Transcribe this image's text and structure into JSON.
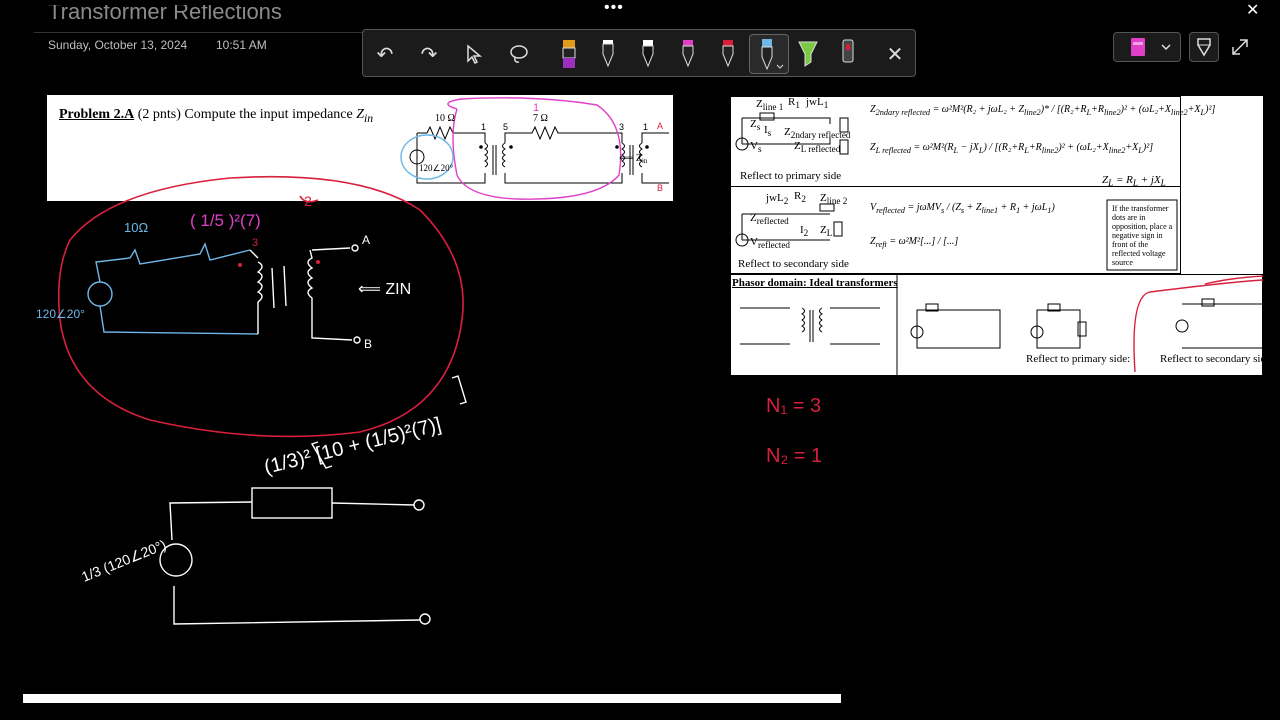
{
  "window": {
    "menu_dots": "•••",
    "close_glyph": "✕"
  },
  "page": {
    "title": "Transformer Reflections",
    "date": "Sunday, October 13, 2024",
    "time": "10:51 AM"
  },
  "toolbar": {
    "undo": "↶",
    "redo": "↷",
    "close": "✕"
  },
  "problem": {
    "heading": "Problem 2.A",
    "points": "(2 pnts)",
    "prompt": "Compute the input impedance",
    "symbol": "Z",
    "subscript": "in",
    "circuit": {
      "r1": "10 Ω",
      "r2": "7 Ω",
      "n1": "1",
      "n2": "5",
      "n3": "3",
      "n4": "1",
      "source": "120∠20°",
      "zin": "⟸ Z",
      "zin_sub": "in",
      "term_a": "A",
      "term_b": "B",
      "mark": "1"
    }
  },
  "reference": {
    "zline1": "Z",
    "zline1_sub": "line 1",
    "r1": "R",
    "r1_sub": "1",
    "jwl1": "jwL",
    "jwl1_sub": "1",
    "zs": "Z",
    "zs_sub": "s",
    "is": "I",
    "is_sub": "s",
    "z2ref": "Z",
    "z2ref_sub": "2ndary reflected",
    "zlref": "Z",
    "zlref_sub": "L reflected",
    "vs": "V",
    "vs_sub": "s",
    "reflect_primary": "Reflect to primary side",
    "zl_eq": "Z",
    "zl_eq_sub": "L",
    "zl_eq_rest": " = R",
    "zl_eq_r_sub": "L",
    "zl_eq_tail": " + jX",
    "zl_eq_x_sub": "L",
    "jwl2": "jwL",
    "jwl2_sub": "2",
    "r2": "R",
    "r2_sub": "2",
    "zline2": "Z",
    "zline2_sub": "line 2",
    "zrefl": "Z",
    "zrefl_sub": "reflected",
    "i2": "I",
    "i2_sub": "2",
    "zl": "Z",
    "zl_sub": "L",
    "vrefl": "V",
    "vrefl_sub": "reflected",
    "reflect_secondary": "Reflect to secondary side",
    "vref_label": "V",
    "vref_label_sub": "reflected",
    "vref_num": "jωMV",
    "vref_num_sub": "s",
    "vref_den": "Z",
    "vref_den_s": "s",
    "vref_den_mid": " + Z",
    "vref_den_line": "line1",
    "vref_den_mid2": " + R",
    "vref_den_r": "1",
    "vref_den_tail": " + jωL",
    "vref_den_l": "1",
    "zreft_label": "Z",
    "zreft_label_sub": "reft",
    "note": "If the transformer dots are in opposition, place a negative sign in front of the reflected voltage source",
    "phasor_title": "Phasor domain: Ideal transformers",
    "reflect_primary2": "Reflect to primary side:",
    "reflect_secondary2": "Reflect to secondary side"
  },
  "handwriting": {
    "res_label": "10Ω",
    "ratio_label": "( 1/5 )²(7)",
    "mark_2": "2",
    "mark_3": "3",
    "source_label": "120∠20°",
    "zin": "⟸ ZIN",
    "term_a": "A",
    "term_b": "B",
    "expr": "(1/3)² [10 + (1/5)²(7)]",
    "source2": "1/3 (120∠20°)",
    "n1": "N₁ = 3",
    "n2": "N₂ = 1"
  },
  "colors": {
    "accent_red": "#d81f3c",
    "ink_blue": "#6fb7e8",
    "ink_pink": "#e040c8",
    "ink_white": "#ffffff"
  }
}
